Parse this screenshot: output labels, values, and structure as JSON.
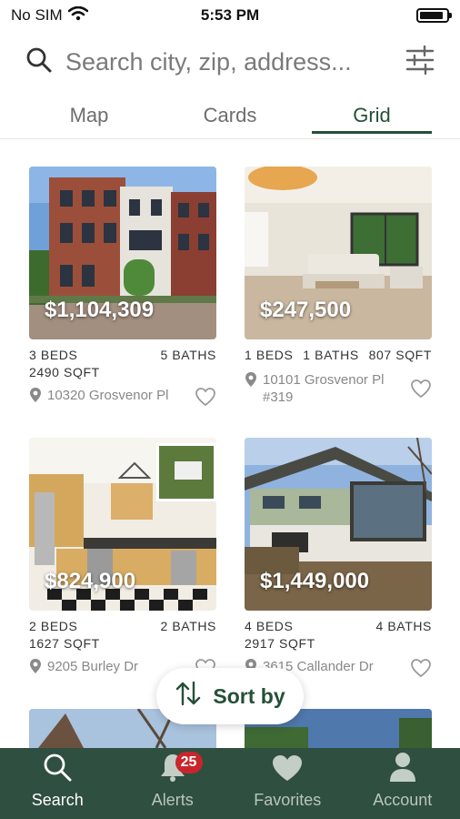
{
  "status_bar": {
    "carrier": "No SIM",
    "time": "5:53 PM",
    "battery_level": 0.9
  },
  "search": {
    "placeholder": "Search city, zip, address..."
  },
  "tabs": [
    {
      "label": "Map",
      "active": false
    },
    {
      "label": "Cards",
      "active": false
    },
    {
      "label": "Grid",
      "active": true
    }
  ],
  "listings": [
    {
      "price": "$1,104,309",
      "beds": "3 BEDS",
      "baths": "5 BATHS",
      "sqft": "2490 SQFT",
      "address": "10320 Grosvenor Pl",
      "photo": "townhouse-exterior"
    },
    {
      "price": "$247,500",
      "beds": "1 BEDS",
      "baths": "1 BATHS",
      "sqft": "807 SQFT",
      "address_line1": "10101 Grosvenor Pl",
      "address_line2": "#319",
      "photo": "living-room-interior"
    },
    {
      "price": "$824,900",
      "beds": "2 BEDS",
      "baths": "2 BATHS",
      "sqft": "1627 SQFT",
      "address": "9205 Burley Dr",
      "photo": "kitchen-interior"
    },
    {
      "price": "$1,449,000",
      "beds": "4 BEDS",
      "baths": "4 BATHS",
      "sqft": "2917 SQFT",
      "address": "3615 Callander Dr",
      "photo": "house-exterior"
    }
  ],
  "sort": {
    "label": "Sort by"
  },
  "bottom_nav": [
    {
      "label": "Search",
      "icon": "search-icon",
      "active": true
    },
    {
      "label": "Alerts",
      "icon": "bell-icon",
      "badge": "25",
      "active": false
    },
    {
      "label": "Favorites",
      "icon": "heart-icon",
      "active": false
    },
    {
      "label": "Account",
      "icon": "person-icon",
      "active": false
    }
  ],
  "colors": {
    "brand_green": "#2f4f40",
    "accent_green": "#245038",
    "badge_red": "#c8262c"
  }
}
